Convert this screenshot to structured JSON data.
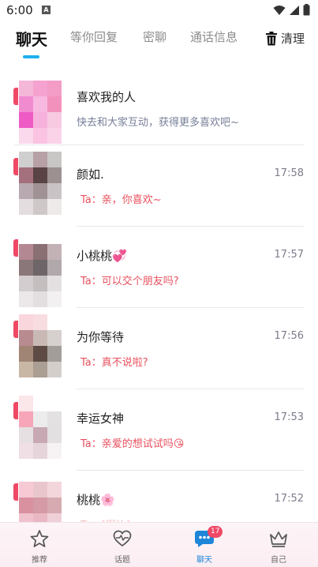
{
  "status_bar": {
    "time": "6:00",
    "notification_letter": "A"
  },
  "tabs": [
    {
      "label": "聊天",
      "active": true
    },
    {
      "label": "等你回复",
      "active": false
    },
    {
      "label": "密聊",
      "active": false
    },
    {
      "label": "通话信息",
      "active": false
    }
  ],
  "clear_label": "清理",
  "likes_row": {
    "title": "喜欢我的人",
    "subtitle": "快去和大家互动，获得更多喜欢吧~"
  },
  "chats": [
    {
      "name": "颜如.",
      "time": "17:58",
      "message": "Ta：亲，你喜欢~"
    },
    {
      "name": "小桃桃💞",
      "time": "17:57",
      "message": "Ta：可以交个朋友吗?"
    },
    {
      "name": "为你等待",
      "time": "17:56",
      "message": "Ta：真不说啦?"
    },
    {
      "name": "幸运女神",
      "time": "17:53",
      "message": "Ta：亲爱的想试试吗😘"
    },
    {
      "name": "桃桃🌸",
      "time": "17:52",
      "message": "Ta：[图片]"
    }
  ],
  "bottom_nav": [
    {
      "label": "推荐",
      "icon": "star-icon"
    },
    {
      "label": "话题",
      "icon": "heart-pulse-icon"
    },
    {
      "label": "聊天",
      "icon": "chat-bubble-icon",
      "badge": "17",
      "active": true
    },
    {
      "label": "自己",
      "icon": "crown-icon"
    }
  ],
  "colors": {
    "accent": "#1fb0ee",
    "message_pink": "#e8505e",
    "badge_red": "#ef4966"
  }
}
